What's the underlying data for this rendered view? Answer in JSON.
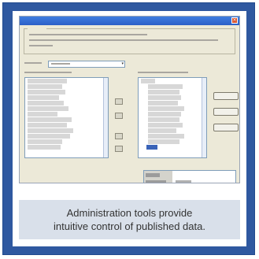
{
  "caption": {
    "line1": "Administration tools provide",
    "line2": "intuitive control of published data."
  },
  "colors": {
    "frame": "#2f58a0",
    "caption_bg": "#d9e0ea",
    "dialog_bg": "#ece9d8",
    "titlebar": "#2b5fc7"
  }
}
